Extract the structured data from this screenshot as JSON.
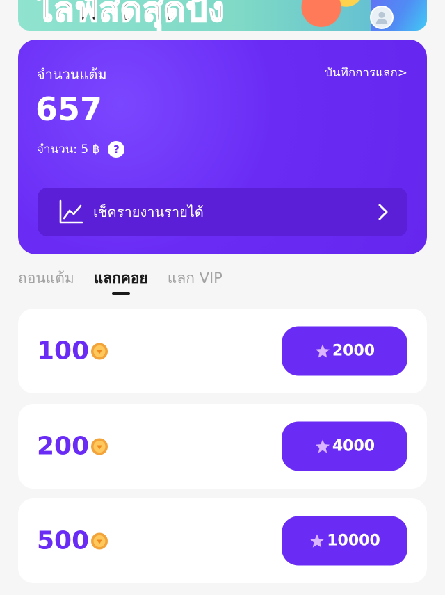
{
  "banner": {
    "title": "ไลฟ์สดสุดปัง"
  },
  "points_card": {
    "label": "จำนวนแต้ม",
    "history_link": "บันทึกการแลก>",
    "points": "657",
    "amount_text": "จำนวน: 5 ฿",
    "help": "?",
    "report_label": "เช็ครายงานรายได้"
  },
  "tabs": [
    {
      "label": "ถอนแต้ม",
      "active": false
    },
    {
      "label": "แลกคอย",
      "active": true
    },
    {
      "label": "แลก VIP",
      "active": false
    }
  ],
  "exchange_items": [
    {
      "coins": "100",
      "price": "2000"
    },
    {
      "coins": "200",
      "price": "4000"
    },
    {
      "coins": "500",
      "price": "10000"
    }
  ],
  "colors": {
    "accent": "#6a2cf5",
    "card_dark": "#5a1fd6",
    "background": "#f6f6f6"
  }
}
